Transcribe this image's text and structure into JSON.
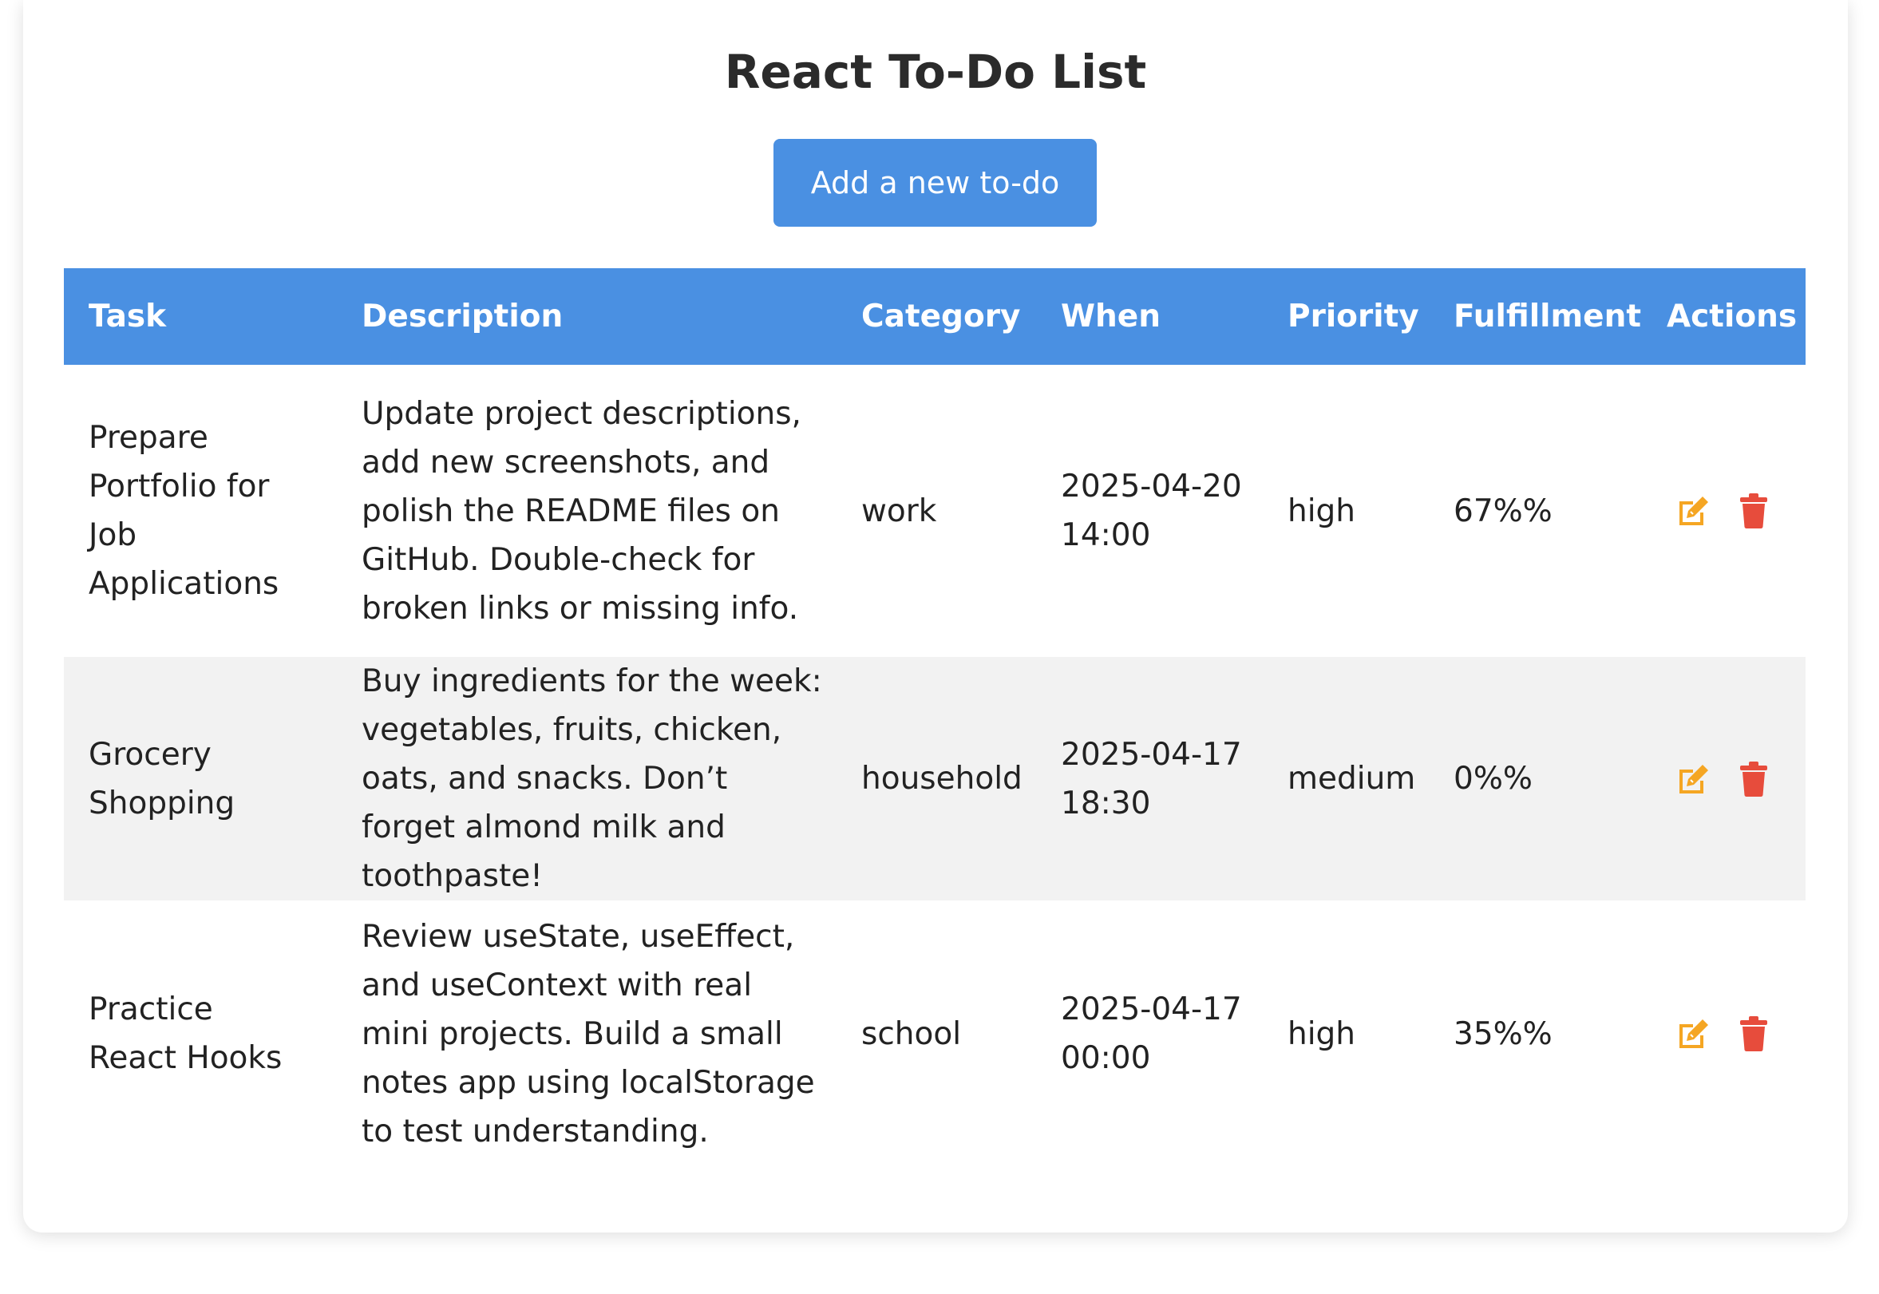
{
  "app": {
    "title": "React To-Do List",
    "add_button_label": "Add a new to-do"
  },
  "colors": {
    "accent": "#4a90e2",
    "edit_icon": "#f5a623",
    "delete_icon": "#e74c3c",
    "alt_row": "#f2f2f2"
  },
  "table": {
    "headers": {
      "task": "Task",
      "description": "Description",
      "category": "Category",
      "when": "When",
      "priority": "Priority",
      "fulfillment": "Fulfillment",
      "actions": "Actions"
    },
    "rows": [
      {
        "task": "Prepare Portfolio for Job Applications",
        "description": "Update project descriptions, add new screenshots, and polish the README files on GitHub. Double-check for broken links or missing info.",
        "category": "work",
        "when_date": "2025-04-20",
        "when_time": "14:00",
        "priority": "high",
        "fulfillment": "67%%",
        "edit_icon": "edit-icon",
        "delete_icon": "trash-icon"
      },
      {
        "task": "Grocery Shopping",
        "description": "Buy ingredients for the week: vegetables, fruits, chicken, oats, and snacks. Don’t forget almond milk and toothpaste!",
        "category": "household",
        "when_date": "2025-04-17",
        "when_time": "18:30",
        "priority": "medium",
        "fulfillment": "0%%",
        "edit_icon": "edit-icon",
        "delete_icon": "trash-icon"
      },
      {
        "task": "Practice React Hooks",
        "description": "Review useState, useEffect, and useContext with real mini projects. Build a small notes app using localStorage to test understanding.",
        "category": "school",
        "when_date": "2025-04-17",
        "when_time": "00:00",
        "priority": "high",
        "fulfillment": "35%%",
        "edit_icon": "edit-icon",
        "delete_icon": "trash-icon"
      }
    ]
  }
}
